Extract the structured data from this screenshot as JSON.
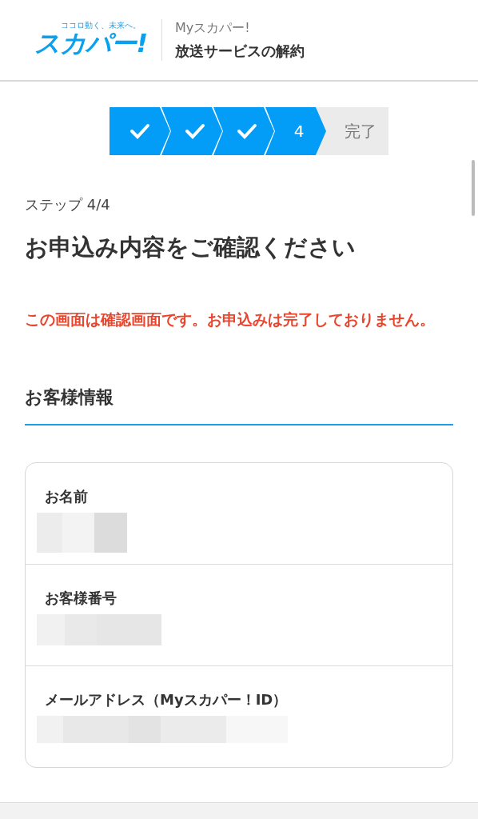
{
  "header": {
    "logo_tagline": "ココロ動く、未来へ。",
    "logo": "スカパー!",
    "service": "Myスカパー!",
    "title": "放送サービスの解約"
  },
  "stepper": [
    {
      "kind": "done"
    },
    {
      "kind": "done"
    },
    {
      "kind": "done"
    },
    {
      "kind": "current",
      "label": "4"
    },
    {
      "kind": "pending",
      "label": "完了"
    }
  ],
  "step_indicator": "ステップ 4/4",
  "heading": "お申込み内容をご確認ください",
  "warning": "この画面は確認画面です。お申込みは完了しておりません。",
  "section_title": "お客様情報",
  "fields": [
    {
      "label": "お名前",
      "kind": "redacted"
    },
    {
      "label": "お客様番号",
      "kind": "redacted"
    },
    {
      "label": "メールアドレス（Myスカパー！ID）",
      "kind": "redacted"
    }
  ]
}
